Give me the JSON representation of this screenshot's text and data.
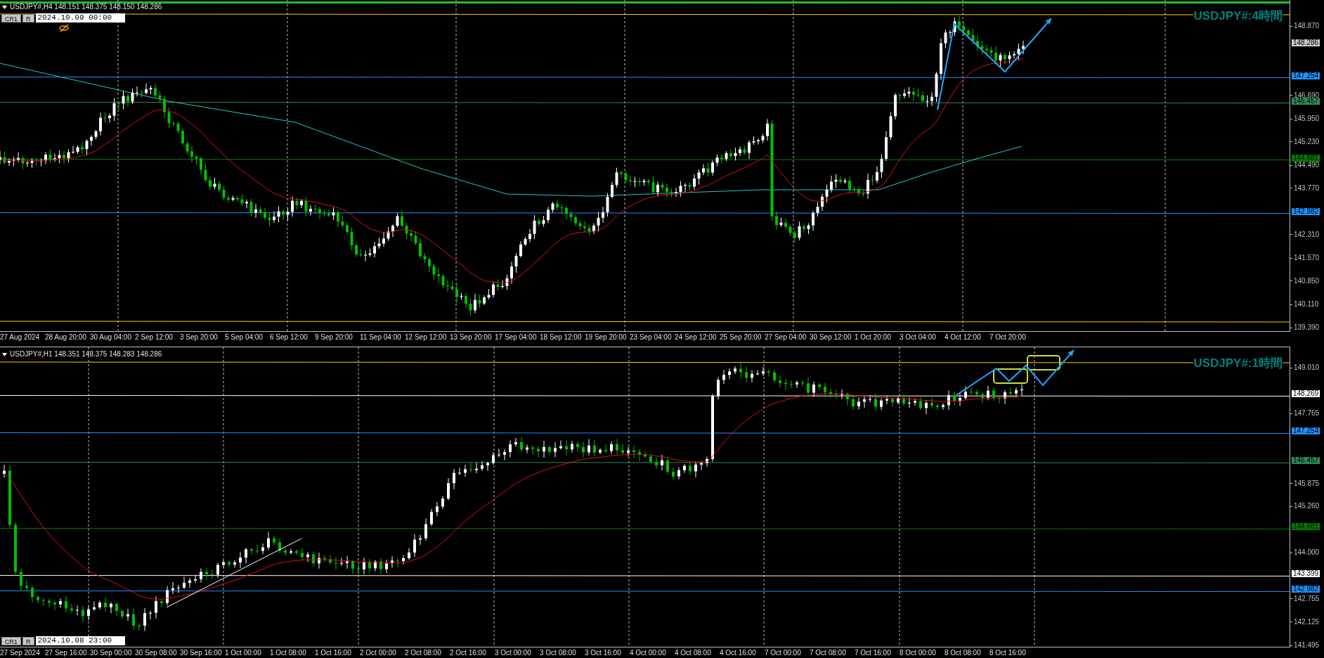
{
  "panels": [
    {
      "kind": "h4",
      "header": "USDJPY#,H4 148.151 148.375 148.150 148.286",
      "buttons": [
        "CR1",
        "R"
      ],
      "date_field": "2024.10.09 00:00",
      "overlay_title": "USDJPY#:4時間",
      "price_ticks": [
        "148.870",
        "146.690",
        "145.950",
        "145.230",
        "144.490",
        "143.770",
        "142.310",
        "141.570",
        "140.850",
        "140.110",
        "139.390"
      ],
      "price_labels": [
        {
          "text": "148.286",
          "color": "#c8c8c8",
          "line": false
        },
        {
          "text": "147.254",
          "color": "#1e90ff",
          "line": true
        },
        {
          "text": "146.457",
          "color": "#2e8b57",
          "line": true
        },
        {
          "text": "144.681",
          "color": "#008000",
          "line": true
        },
        {
          "text": "142.982",
          "color": "#1e90ff",
          "line": true
        }
      ],
      "time_labels": [
        "27 Aug 2024",
        "28 Aug 20:00",
        "30 Aug 04:00",
        "2 Sep 12:00",
        "3 Sep 20:00",
        "5 Sep 04:00",
        "6 Sep 12:00",
        "9 Sep 20:00",
        "11 Sep 04:00",
        "12 Sep 12:00",
        "13 Sep 20:00",
        "17 Sep 04:00",
        "18 Sep 12:00",
        "19 Sep 20:00",
        "23 Sep 04:00",
        "24 Sep 12:00",
        "25 Sep 20:00",
        "27 Sep 04:00",
        "30 Sep 12:00",
        "1 Oct 20:00",
        "3 Oct 04:00",
        "4 Oct 12:00",
        "7 Oct 20:00"
      ]
    },
    {
      "kind": "h1",
      "header": "USDJPY#,H1 148.351 148.375 148.283 148.286",
      "buttons": [
        "CR1",
        "R"
      ],
      "date_field": "2024.10.08 23:00",
      "overlay_title": "USDJPY#:1時間",
      "price_ticks": [
        "149.010",
        "147.765",
        "145.875",
        "145.260",
        "144.000",
        "142.755",
        "142.125",
        "141.495"
      ],
      "price_labels": [
        {
          "text": "148.269",
          "color": "#ffffff",
          "line": true
        },
        {
          "text": "147.254",
          "color": "#1e90ff",
          "line": true
        },
        {
          "text": "146.457",
          "color": "#2e8b57",
          "line": true
        },
        {
          "text": "144.681",
          "color": "#008000",
          "line": true
        },
        {
          "text": "143.399",
          "color": "#ffffff",
          "line": true
        },
        {
          "text": "142.982",
          "color": "#1e90ff",
          "line": true
        }
      ],
      "time_labels": [
        "27 Sep 2024",
        "27 Sep 16:00",
        "30 Sep 00:00",
        "30 Sep 08:00",
        "30 Sep 16:00",
        "1 Oct 00:00",
        "1 Oct 08:00",
        "1 Oct 16:00",
        "2 Oct 00:00",
        "2 Oct 08:00",
        "2 Oct 16:00",
        "3 Oct 00:00",
        "3 Oct 08:00",
        "3 Oct 16:00",
        "4 Oct 00:00",
        "4 Oct 08:00",
        "4 Oct 16:00",
        "7 Oct 00:00",
        "7 Oct 08:00",
        "7 Oct 16:00",
        "8 Oct 00:00",
        "8 Oct 08:00",
        "8 Oct 16:00"
      ]
    }
  ]
}
